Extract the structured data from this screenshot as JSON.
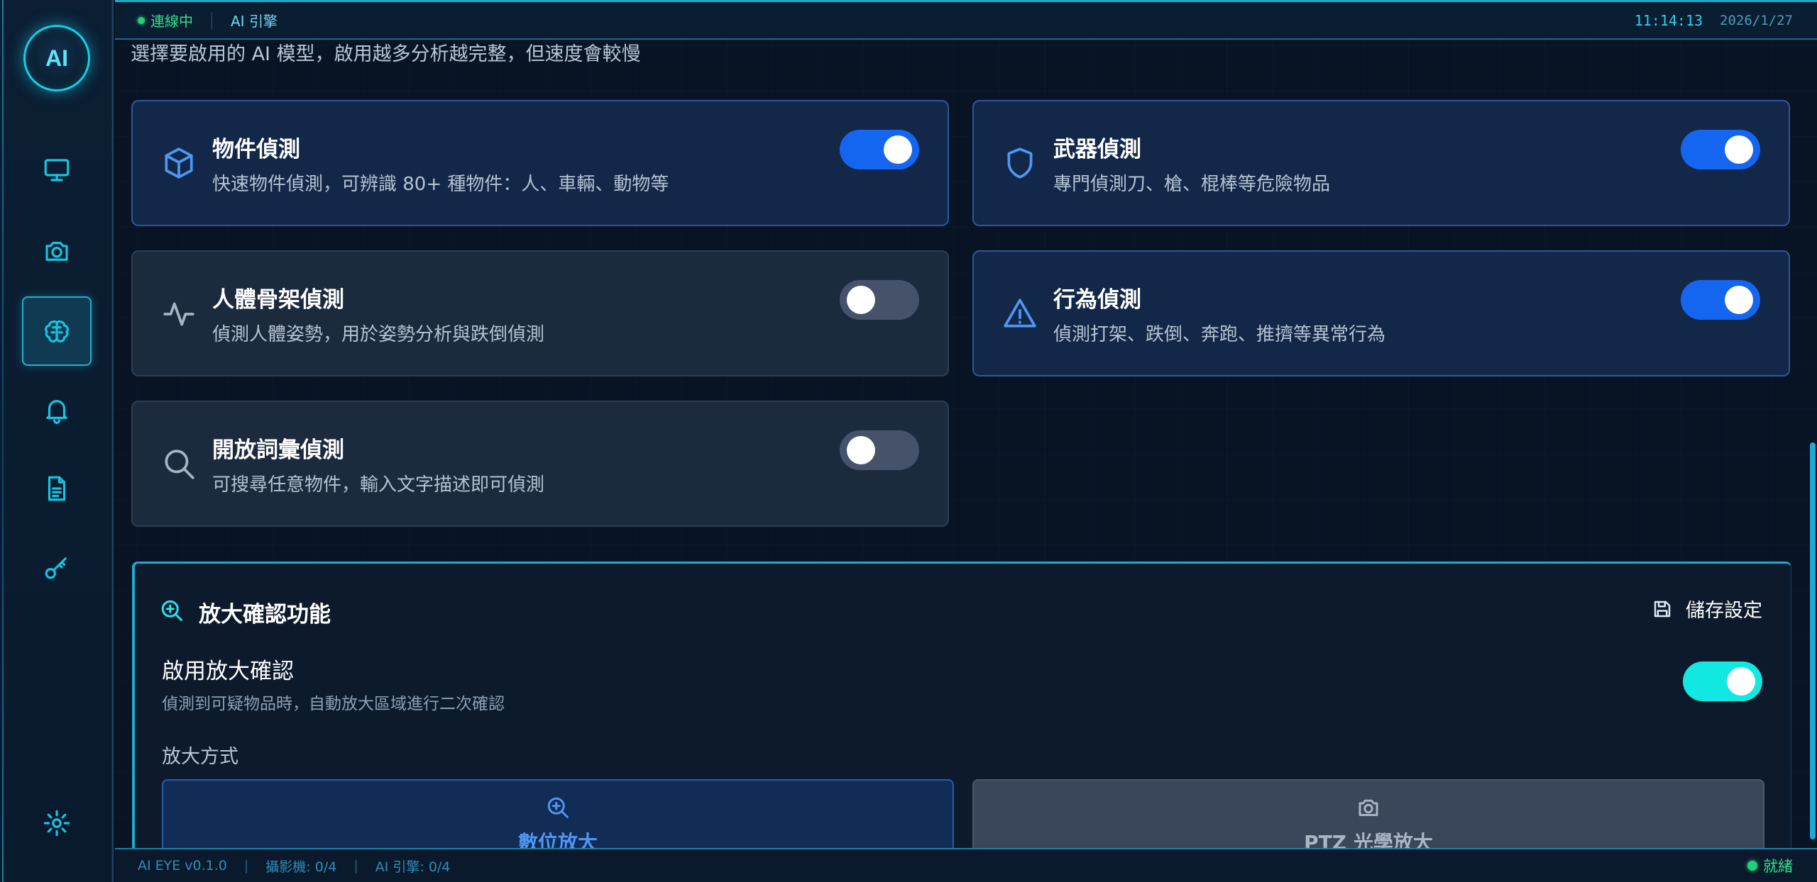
{
  "colors": {
    "accent_cyan": "#16cde8",
    "toggle_on": "#1466f0",
    "toggle_off": "#45526a",
    "toggle_cyan": "#12e8e2",
    "status_green": "#1fd17a"
  },
  "sidebar": {
    "logo": "AI",
    "items": [
      {
        "name": "monitor",
        "icon": "monitor-icon",
        "active": false
      },
      {
        "name": "camera",
        "icon": "camera-icon",
        "active": false
      },
      {
        "name": "ai-brain",
        "icon": "brain-icon",
        "active": true
      },
      {
        "name": "alerts",
        "icon": "bell-icon",
        "active": false
      },
      {
        "name": "reports",
        "icon": "document-icon",
        "active": false
      },
      {
        "name": "license",
        "icon": "key-icon",
        "active": false
      },
      {
        "name": "settings",
        "icon": "gear-icon",
        "active": false
      }
    ]
  },
  "topbar": {
    "status": "連線中",
    "engine": "AI 引擎",
    "time": "11:14:13",
    "date": "2026/1/27"
  },
  "main": {
    "subtitle": "選擇要啟用的 AI 模型，啟用越多分析越完整，但速度會較慢",
    "models": [
      {
        "title": "物件偵測",
        "desc": "快速物件偵測，可辨識 80+ 種物件：人、車輛、動物等",
        "enabled": true,
        "icon": "cube-icon"
      },
      {
        "title": "武器偵測",
        "desc": "專門偵測刀、槍、棍棒等危險物品",
        "enabled": true,
        "icon": "shield-icon"
      },
      {
        "title": "人體骨架偵測",
        "desc": "偵測人體姿勢，用於姿勢分析與跌倒偵測",
        "enabled": false,
        "icon": "pulse-icon"
      },
      {
        "title": "行為偵測",
        "desc": "偵測打架、跌倒、奔跑、推擠等異常行為",
        "enabled": true,
        "icon": "warning-icon"
      },
      {
        "title": "開放詞彙偵測",
        "desc": "可搜尋任意物件，輸入文字描述即可偵測",
        "enabled": false,
        "icon": "search-icon"
      }
    ]
  },
  "zoom_panel": {
    "title": "放大確認功能",
    "save_label": "儲存設定",
    "option_title": "啟用放大確認",
    "option_desc": "偵測到可疑物品時，自動放大區域進行二次確認",
    "option_enabled": true,
    "mode_label": "放大方式",
    "modes": [
      {
        "label": "數位放大",
        "selected": true,
        "icon": "zoom-in-icon"
      },
      {
        "label": "PTZ 光學放大",
        "selected": false,
        "icon": "camera-icon"
      }
    ]
  },
  "footer": {
    "version": "AI EYE v0.1.0",
    "sep": "|",
    "cameras": "攝影機: 0/4",
    "engines": "AI 引擎: 0/4",
    "status": "就緒"
  }
}
